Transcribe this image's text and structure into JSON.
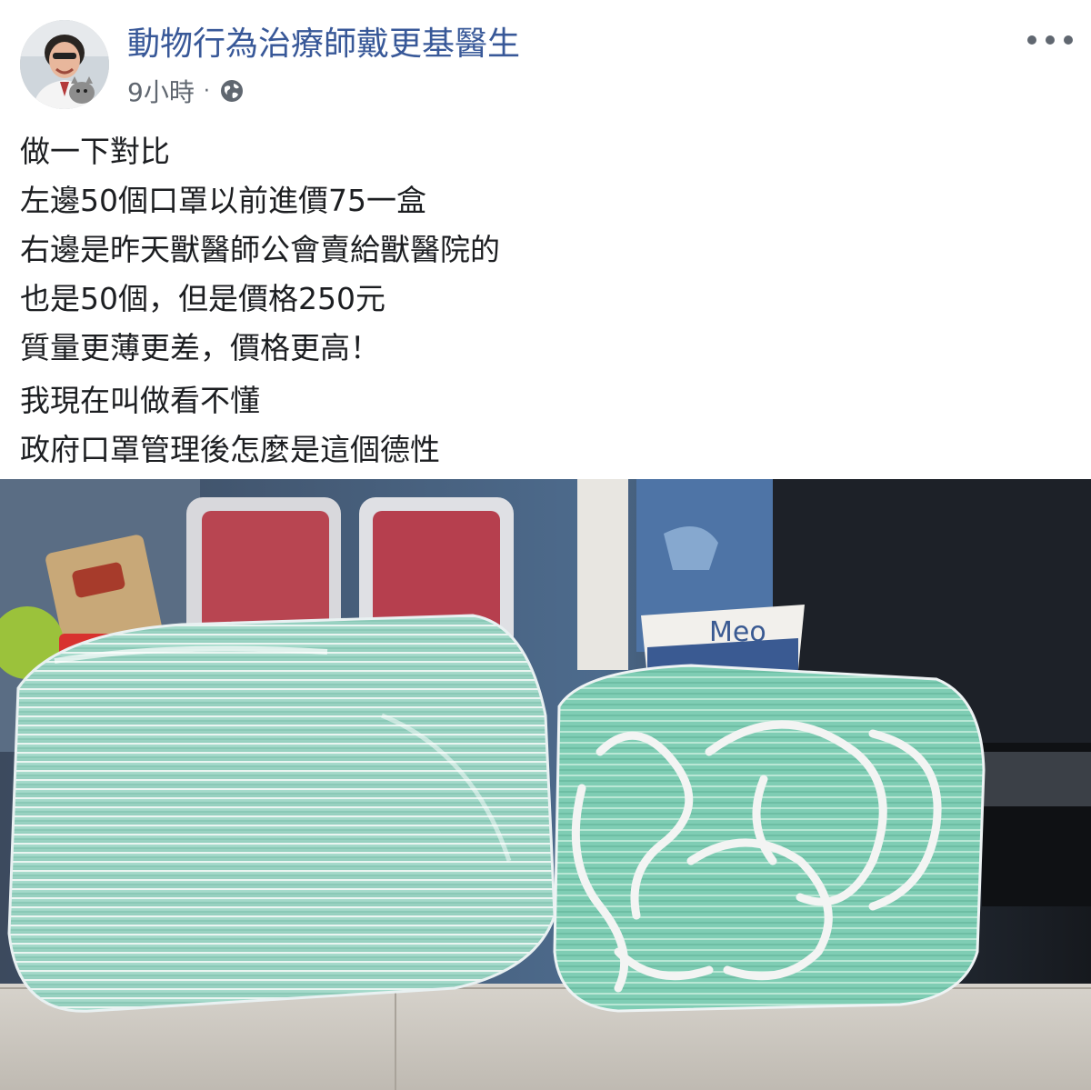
{
  "post": {
    "author": "動物行為治療師戴更基醫生",
    "time": "9小時",
    "separator": "·",
    "privacy_icon": "globe-icon",
    "more_icon": "more-horizontal-icon",
    "paragraphs": [
      {
        "lines": [
          "做一下對比",
          "左邊50個口罩以前進價75一盒",
          "右邊是昨天獸醫師公會賣給獸醫院的",
          "也是50個，但是價格250元",
          "質量更薄更差，價格更高！"
        ]
      },
      {
        "lines": [
          "我現在叫做看不懂",
          "政府口罩管理後怎麼是這個德性"
        ]
      }
    ],
    "photo": {
      "cup_text": "Meo"
    }
  },
  "colors": {
    "author": "#385898",
    "meta": "#606770",
    "text": "#1c1e21",
    "mask_green": "#7fcfb8",
    "background": "#ffffff"
  }
}
